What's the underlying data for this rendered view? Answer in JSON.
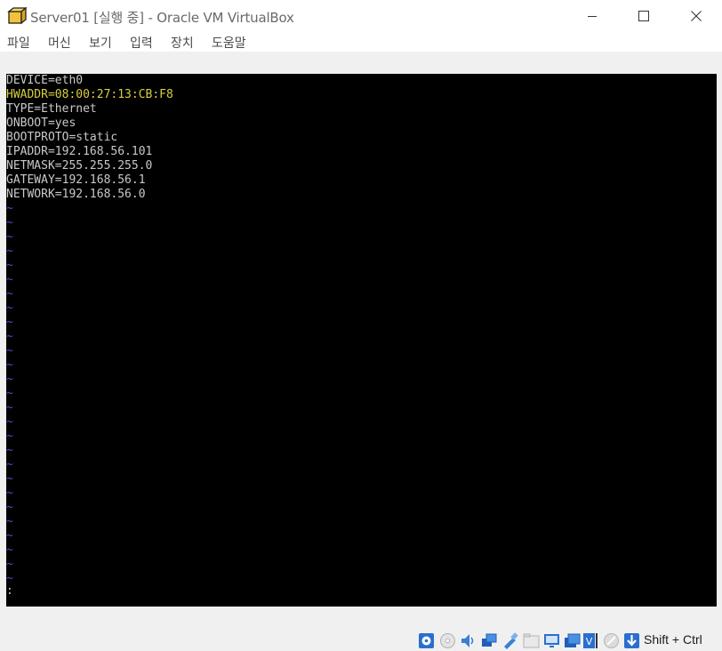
{
  "window": {
    "title": "Server01 [실행 중] - Oracle VM VirtualBox",
    "app_icon": "virtualbox-cube-icon",
    "controls": [
      "minimize-icon",
      "maximize-icon",
      "close-icon"
    ]
  },
  "menu": {
    "items": [
      "파일",
      "머신",
      "보기",
      "입력",
      "장치",
      "도움말"
    ]
  },
  "terminal": {
    "lines": [
      "DEVICE=eth0",
      "HWADDR=08:00:27:13:CB:F8",
      "TYPE=Ethernet",
      "ONBOOT=yes",
      "BOOTPROTO=static",
      "IPADDR=192.168.56.101",
      "NETMASK=255.255.255.0",
      "GATEWAY=192.168.56.1",
      "NETWORK=192.168.56.0"
    ],
    "highlighted_line_index": 1,
    "tilde_char": "~",
    "tilde_count": 27,
    "command_line": ":",
    "colors": {
      "background": "#000000",
      "text": "#c9c9c9",
      "highlight": "#d7cf3e",
      "tilde": "#4d4dd8"
    }
  },
  "statusbar": {
    "icons": [
      "hard-disk-icon",
      "optical-drive-icon",
      "audio-icon",
      "network-icon",
      "usb-icon",
      "shared-folders-icon",
      "display-icon",
      "recording-icon",
      "virtualization-icon",
      "mouse-integration-icon",
      "keyboard-capture-icon"
    ],
    "host_key": "Shift + Ctrl"
  }
}
